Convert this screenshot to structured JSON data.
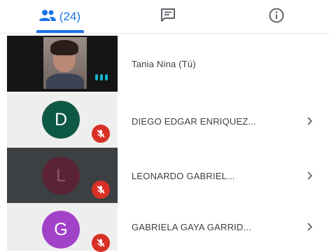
{
  "tabs": {
    "people_count": "(24)",
    "people_icon": "people-icon",
    "chat_icon": "chat-icon",
    "info_icon": "info-icon"
  },
  "colors": {
    "accent": "#1a73e8",
    "mute_badge": "#d93025",
    "speaking_indicator": "#12b5cb"
  },
  "participants": [
    {
      "name": "Tania Nina (Tú)",
      "tile_type": "video",
      "tile_bg": "#151515",
      "muted": false,
      "speaking": true,
      "has_chevron": false
    },
    {
      "name": "DIEGO EDGAR ENRIQUEZ...",
      "initial": "D",
      "avatar_color": "#0e5944",
      "tile_bg": "#eeeeee",
      "muted": true,
      "has_chevron": true
    },
    {
      "name": "LEONARDO GABRIEL...",
      "initial": "L",
      "avatar_color": "#5a2434",
      "tile_bg": "#3c4043",
      "muted": true,
      "has_chevron": true
    },
    {
      "name": "GABRIELA GAYA GARRID...",
      "initial": "G",
      "avatar_color": "#a142c8",
      "tile_bg": "#eeeeee",
      "muted": true,
      "has_chevron": true
    }
  ]
}
